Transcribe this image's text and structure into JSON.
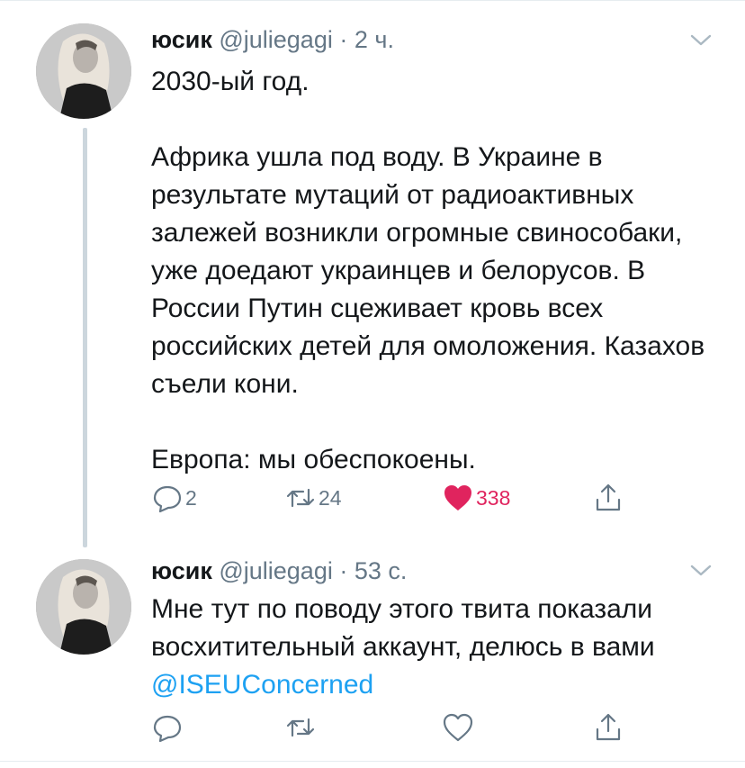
{
  "tweets": [
    {
      "author": {
        "name": "юсик",
        "handle": "@juliegagi",
        "separator": "·",
        "time": "2 ч."
      },
      "text": {
        "line1": "2030-ый год.",
        "line2": "Африка ушла под воду. В Украине в результате мутаций от радиоактивных залежей возникли огромные свинособаки, уже доедают украинцев и белорусов. В России Путин сцеживает кровь всех российских детей для омоложения. Казахов съели кони.",
        "line3": "Европа: мы обеспокоены."
      },
      "actions": {
        "replies": "2",
        "retweets": "24",
        "likes": "338",
        "liked": true
      }
    },
    {
      "author": {
        "name": "юсик",
        "handle": "@juliegagi",
        "separator": "·",
        "time": "53 с."
      },
      "text": {
        "main": "Мне тут по поводу этого твита показали восхитительный аккаунт, делюсь в вами",
        "mention": "@ISEUConcerned"
      },
      "actions": {
        "replies": "",
        "retweets": "",
        "likes": "",
        "liked": false
      }
    }
  ],
  "icons": {
    "reply": "reply-icon",
    "retweet": "retweet-icon",
    "like": "heart-icon",
    "share": "share-icon",
    "more": "chevron-down-icon"
  },
  "colors": {
    "accent": "#1da1f2",
    "like": "#e0245e",
    "secondary_text": "#657786",
    "thread_line": "#ccd6dd"
  }
}
